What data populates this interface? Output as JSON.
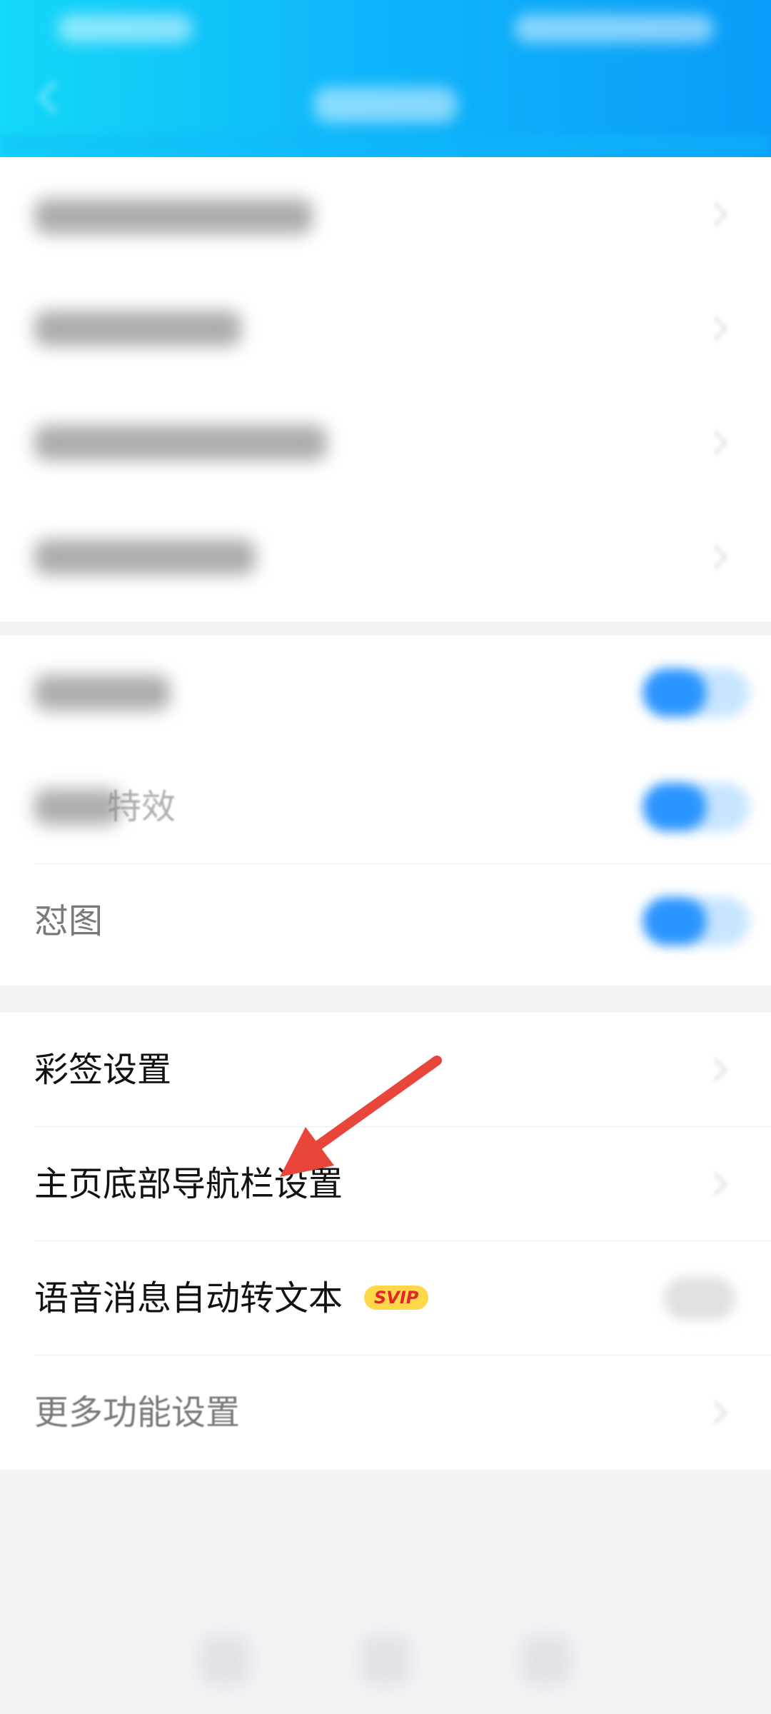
{
  "header": {
    "status_left": "",
    "status_right": "",
    "title": ""
  },
  "group1": {
    "rows": [
      {
        "label": "",
        "chevron": true
      },
      {
        "label": "",
        "chevron": true
      },
      {
        "label": "",
        "chevron": true
      },
      {
        "label": "",
        "chevron": true
      }
    ]
  },
  "group2": {
    "rows": [
      {
        "label": "",
        "toggle": "on"
      },
      {
        "label": "特效",
        "toggle": "on"
      },
      {
        "label": "怼图",
        "toggle": "on"
      }
    ]
  },
  "group3": {
    "rows": [
      {
        "label": "彩签设置",
        "chevron": true
      },
      {
        "label": "主页底部导航栏设置",
        "chevron": true
      },
      {
        "label": "语音消息自动转文本",
        "badge": "SVIP",
        "toggle": "off"
      },
      {
        "label": "更多功能设置",
        "chevron": true
      }
    ]
  },
  "colors": {
    "header_start": "#13d8f7",
    "header_end": "#0a9cf7",
    "toggle_on": "#2b95ff",
    "badge_bg": "#ffd84a",
    "badge_text": "#e0262b",
    "annotation_arrow": "#e8463a"
  },
  "annotation": {
    "type": "arrow",
    "points_to": "主页底部导航栏设置"
  },
  "navbar": {
    "icons": [
      "back-nav-icon",
      "home-nav-icon",
      "recents-nav-icon"
    ]
  }
}
